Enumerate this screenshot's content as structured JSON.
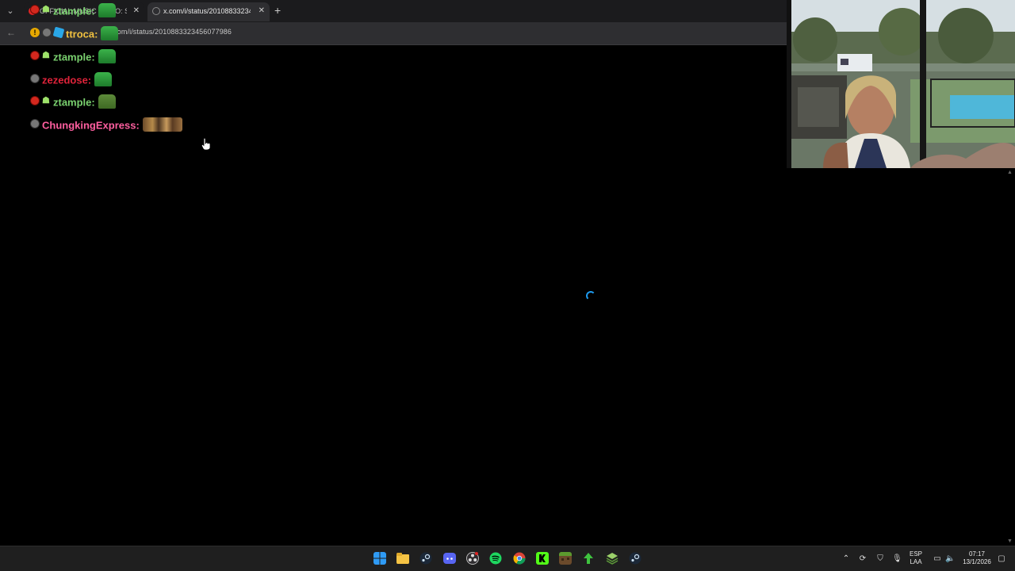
{
  "browser": {
    "tabs": [
      {
        "title": "OFFICIAL MUSIC VIDEO: S",
        "active": false
      },
      {
        "title": "x.com/i/status/2010883323456",
        "active": true
      }
    ],
    "url": "x.com/i/status/2010883323456077986",
    "url_visible_prefix": "x.co",
    "url_visible_suffix": "/i/status/2010883323456077986"
  },
  "chat": {
    "messages": [
      {
        "user": "ztample:",
        "color": "#7ad16f",
        "badges": [
          "red",
          "bot"
        ],
        "emote": "green"
      },
      {
        "user": "ttroca:",
        "color": "#f0c040",
        "badges": [
          "yellow",
          "gray",
          "blue"
        ],
        "emote": "green"
      },
      {
        "user": "ztample:",
        "color": "#7ad16f",
        "badges": [
          "red",
          "bot"
        ],
        "emote": "green"
      },
      {
        "user": "zezedose:",
        "color": "#e0233a",
        "badges": [
          "gray"
        ],
        "emote": "green"
      },
      {
        "user": "ztample:",
        "color": "#7ad16f",
        "badges": [
          "red",
          "bot"
        ],
        "emote": "olive"
      },
      {
        "user": "ChungkingExpress:",
        "color": "#ff5fa0",
        "badges": [
          "gray"
        ],
        "emote": "faces"
      }
    ]
  },
  "webcam": {
    "label": "webcam-feed"
  },
  "taskbar": {
    "apps": [
      "windows-start",
      "file-explorer",
      "steam",
      "discord",
      "obs",
      "spotify",
      "chrome",
      "kick",
      "minecraft",
      "store",
      "app-stack",
      "steam-2"
    ],
    "lang_line1": "ESP",
    "lang_line2": "LAA",
    "time": "07:17",
    "date": "13/1/2026"
  },
  "colors": {
    "accent": "#1d9bf0",
    "background": "#000000"
  }
}
